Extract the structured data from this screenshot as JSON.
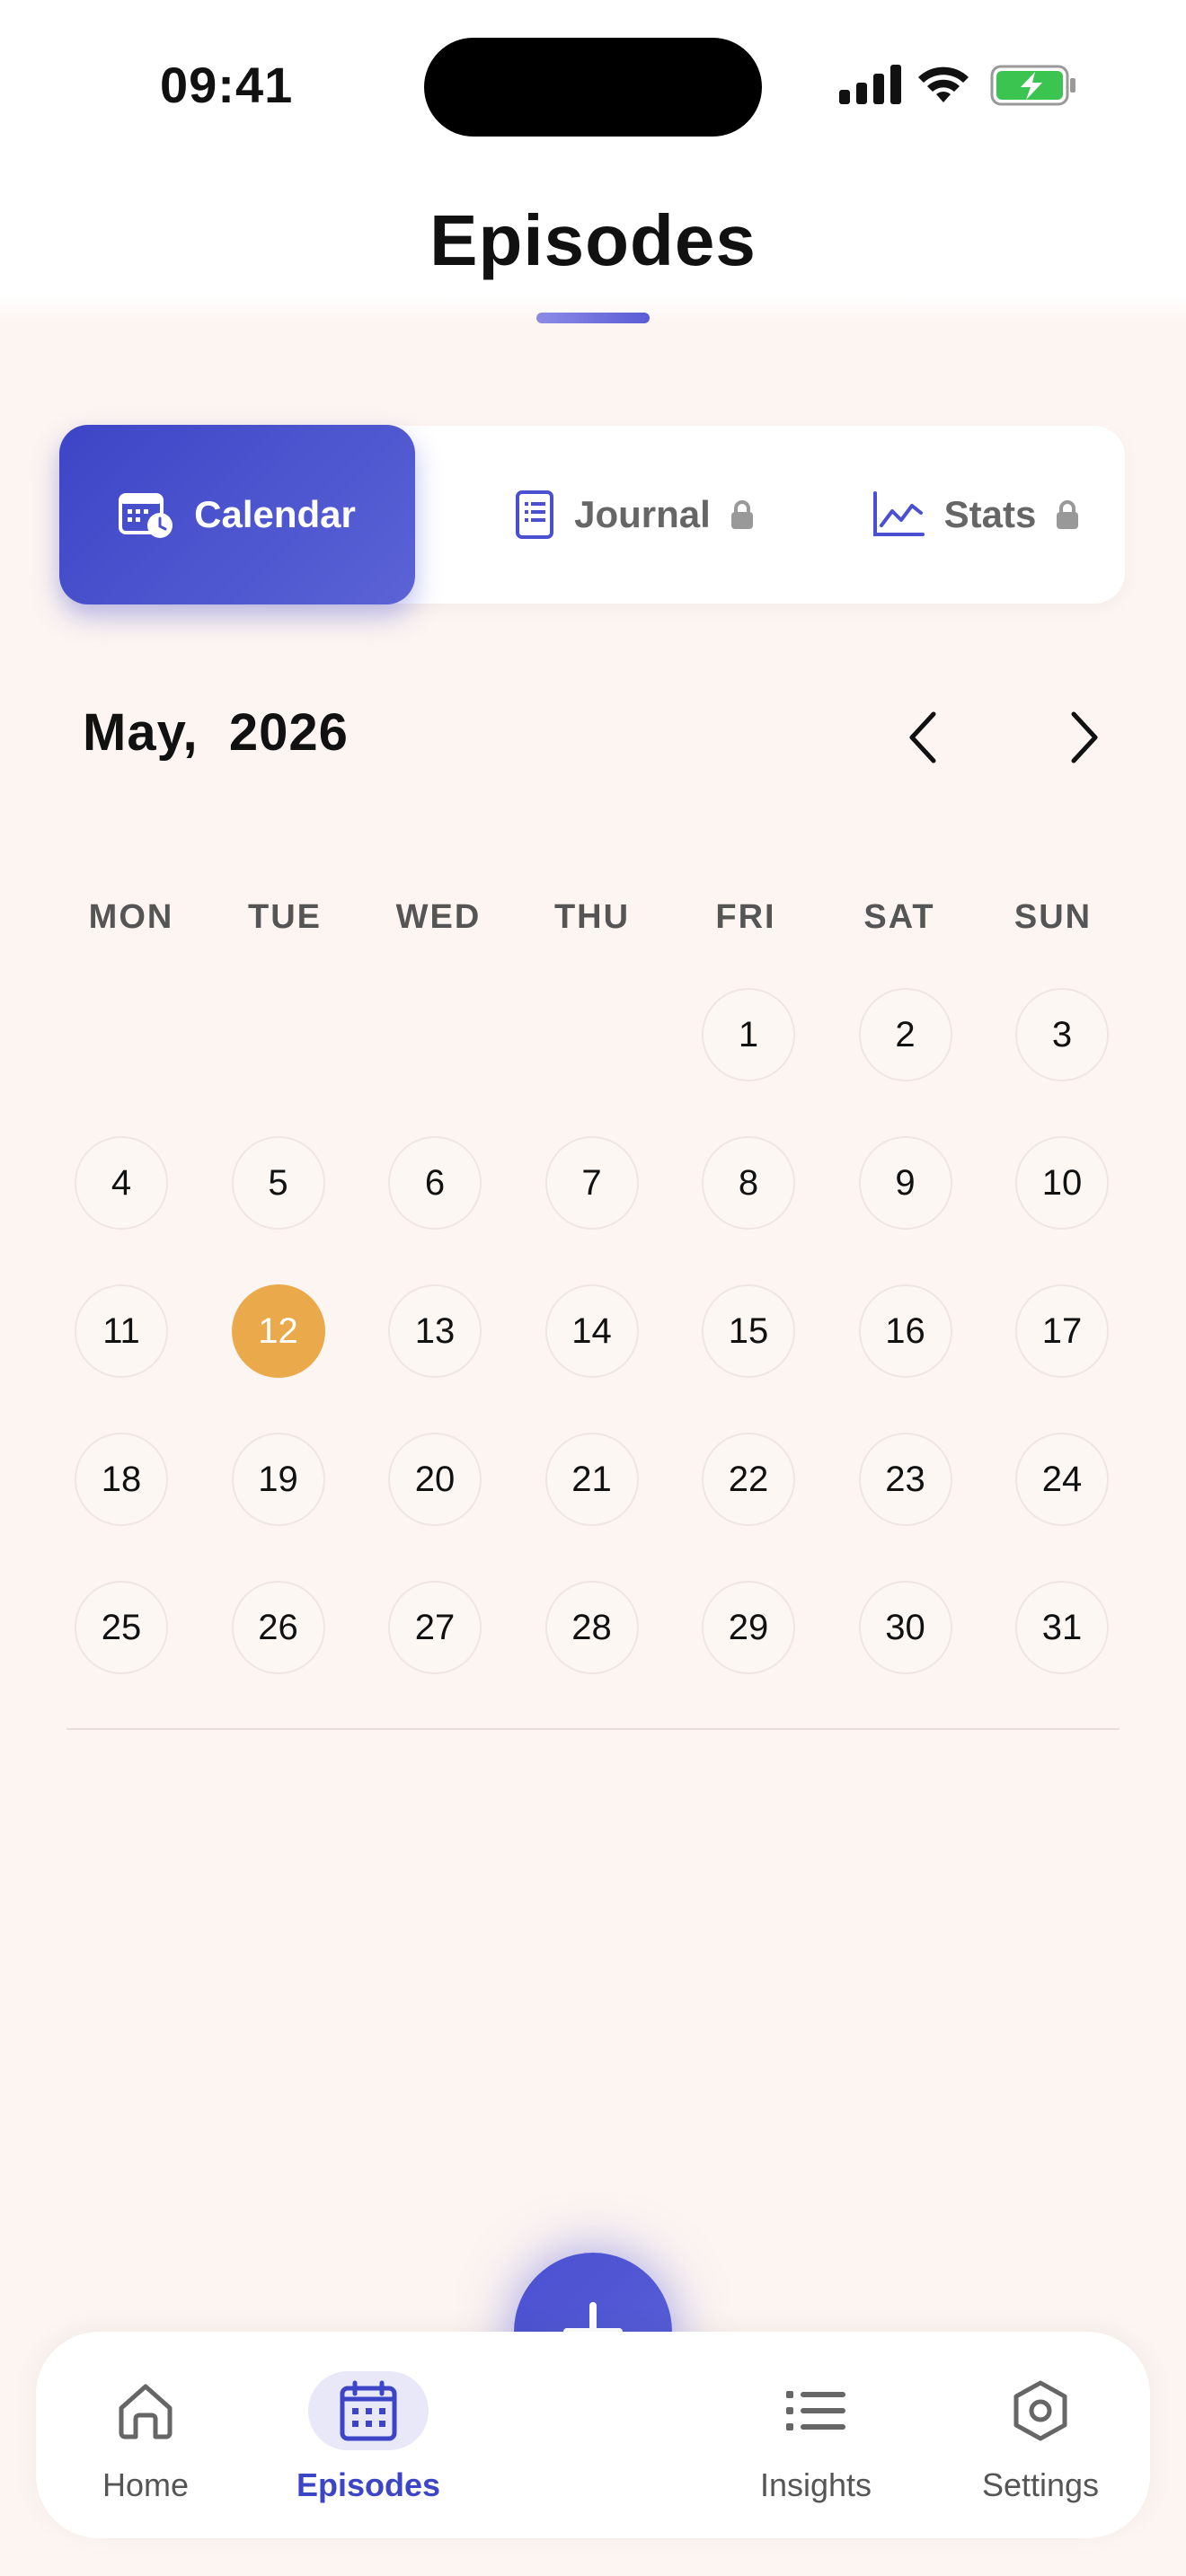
{
  "status_bar": {
    "time": "09:41"
  },
  "page": {
    "title": "Episodes"
  },
  "tabs": [
    {
      "label": "Calendar",
      "icon": "calendar-clock-icon",
      "active": true,
      "locked": false
    },
    {
      "label": "Journal",
      "icon": "journal-icon",
      "active": false,
      "locked": true
    },
    {
      "label": "Stats",
      "icon": "chart-line-icon",
      "active": false,
      "locked": true
    }
  ],
  "calendar": {
    "month_label": "May,  2026",
    "weekdays": [
      "MON",
      "TUE",
      "WED",
      "THU",
      "FRI",
      "SAT",
      "SUN"
    ],
    "first_weekday_index": 4,
    "days_in_month": 31,
    "today": 12
  },
  "bottom_nav": {
    "items": [
      {
        "label": "Home",
        "icon": "home-icon"
      },
      {
        "label": "Episodes",
        "icon": "calendar-icon",
        "active": true
      },
      {
        "label": "Insights",
        "icon": "list-icon"
      },
      {
        "label": "Settings",
        "icon": "settings-icon"
      }
    ],
    "fab_icon": "plus-icon"
  },
  "colors": {
    "accent": "#4a50d0",
    "today": "#eaa94a",
    "background": "#fdf5f1"
  }
}
